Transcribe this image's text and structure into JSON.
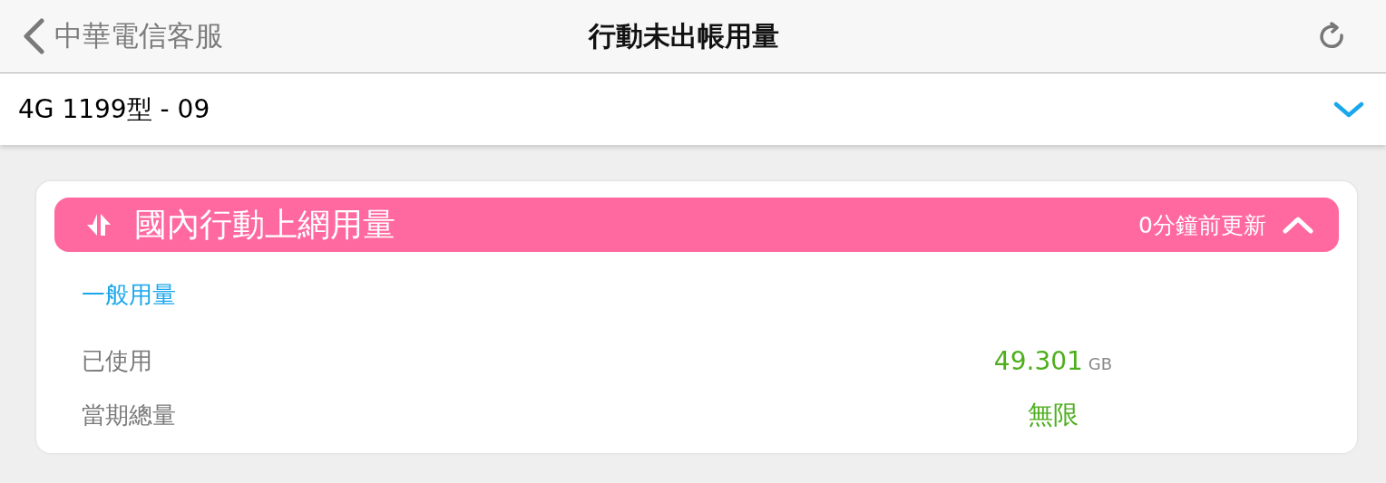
{
  "nav_bar": {
    "back_label": "中華電信客服",
    "title": "行動未出帳用量"
  },
  "plan_picker": {
    "value": "4G 1199型 - 09"
  },
  "usage_card": {
    "title": "國內行動上網用量",
    "updated": "0分鐘前更新",
    "expanded": true,
    "section_title": "一般用量",
    "rows": [
      {
        "label": "已使用",
        "value": "49.301",
        "unit": "GB"
      },
      {
        "label": "當期總量",
        "value": "無限"
      }
    ]
  }
}
